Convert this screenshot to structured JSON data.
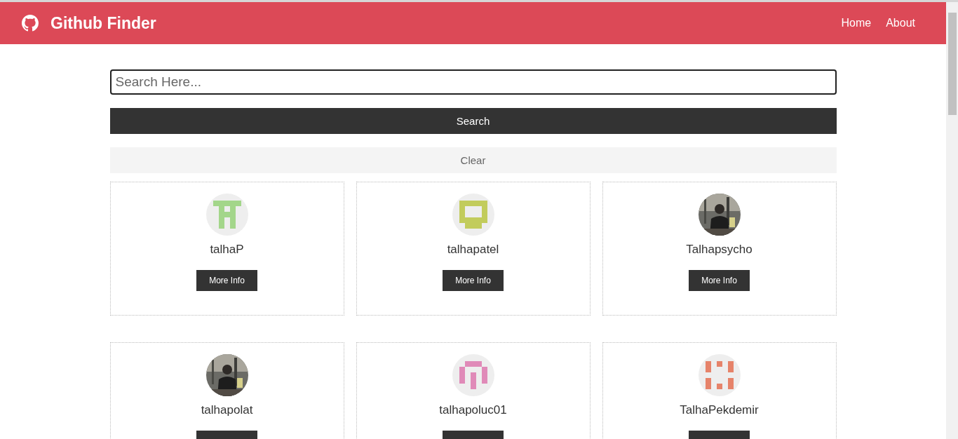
{
  "navbar": {
    "title": "Github Finder",
    "links": [
      {
        "label": "Home"
      },
      {
        "label": "About"
      }
    ]
  },
  "search": {
    "placeholder": "Search Here...",
    "submit": "Search",
    "clear": "Clear"
  },
  "users": [
    {
      "login": "talhaP",
      "kind": "identicon",
      "color": "#a3d68a",
      "action": "More Info"
    },
    {
      "login": "talhapatel",
      "kind": "identicon",
      "color": "#c2cc5c",
      "action": "More Info"
    },
    {
      "login": "Talhapsycho",
      "action": "More Info"
    },
    {
      "login": "talhapolat"
    },
    {
      "login": "talhapoluc01",
      "kind": "identicon",
      "color": "#e08ab8"
    },
    {
      "login": "TalhaPekdemir",
      "kind": "identicon",
      "color": "#e6836a"
    }
  ]
}
